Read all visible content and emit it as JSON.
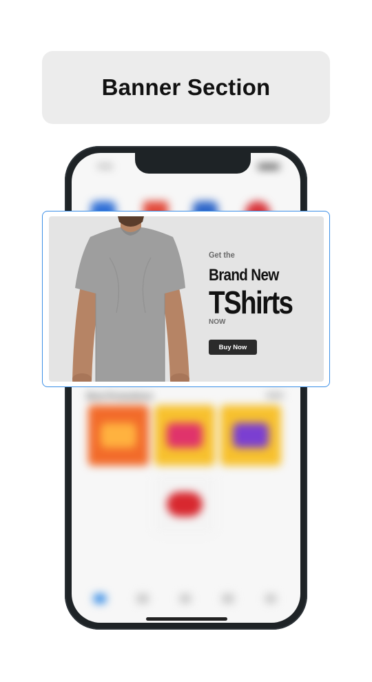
{
  "section": {
    "title": "Banner Section"
  },
  "phone": {
    "status_time": "9:41",
    "promotions_heading": "Best Promotions",
    "category_icons": [
      "category-icon-blue",
      "category-icon-red-triangle",
      "category-icon-blue-bag",
      "category-icon-red"
    ],
    "promo_tiles": [
      {
        "name": "promo-tile-orange",
        "bg": "#f26b2a",
        "inner": "#ffb23f"
      },
      {
        "name": "promo-tile-yellow-sale",
        "bg": "#f7c12e",
        "inner": "#e0336b"
      },
      {
        "name": "promo-tile-yellow-purple",
        "bg": "#f7c12e",
        "inner": "#7b3fd1"
      },
      {
        "name": "promo-tile-red-badge",
        "bg": "#f4f4f4",
        "inner": "#d8282f"
      }
    ],
    "bottom_nav": [
      "home-icon",
      "grid-icon",
      "search-icon",
      "cart-icon",
      "profile-icon"
    ]
  },
  "banner": {
    "eyebrow": "Get the",
    "headline_line1": "Brand New",
    "headline_line2": "TShirts",
    "tagline": "NOW",
    "cta_label": "Buy Now"
  },
  "colors": {
    "highlight_border": "#3a8ee6",
    "banner_bg": "#e4e4e4",
    "cta_bg": "#2b2b2b",
    "phone_frame": "#1e2326",
    "title_card_bg": "#ececec"
  }
}
